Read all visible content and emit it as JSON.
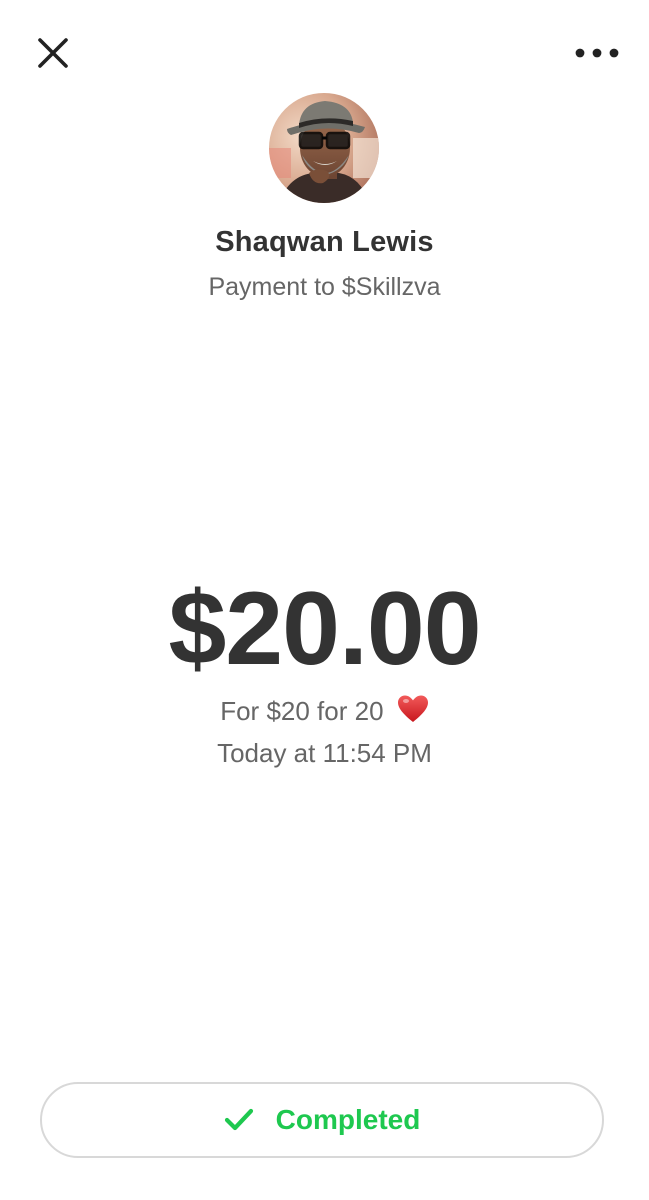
{
  "header": {
    "close_icon": "close-icon",
    "more_icon": "more-dots-icon"
  },
  "recipient": {
    "avatar_icon": "avatar-photo",
    "name": "Shaqwan Lewis",
    "subtitle": "Payment to $Skillzva"
  },
  "payment": {
    "amount": "$20.00",
    "memo": "For $20 for 20",
    "memo_emoji": "heart-emoji",
    "timestamp": "Today at 11:54 PM"
  },
  "status": {
    "label": "Completed",
    "icon": "checkmark-icon",
    "color": "#1ec84f"
  }
}
